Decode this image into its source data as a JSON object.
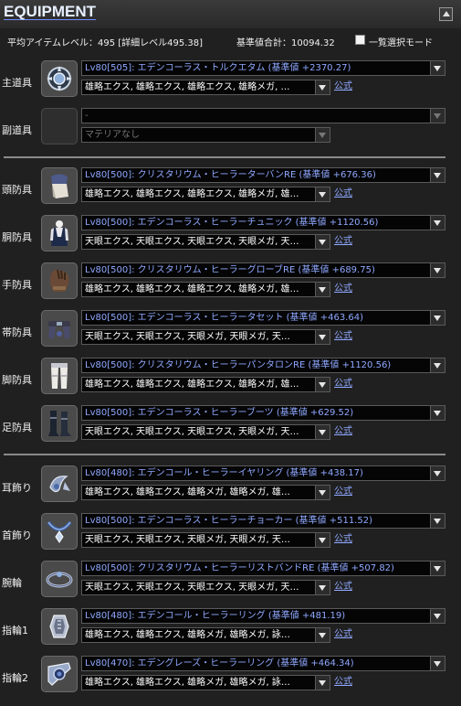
{
  "header": {
    "title": "EQUIPMENT"
  },
  "summary": {
    "avg_level": "平均アイテムレベル：495 [詳細レベル495.38]",
    "total": "基準値合計：10094.32",
    "list_mode": "一覧選択モード"
  },
  "colors": {
    "accent": "#8fa8ff",
    "background": "#202020",
    "field": "#050505"
  },
  "slots": [
    {
      "label": "主道具",
      "icon": "main-hand-icon",
      "item": "Lv80[505]: エデンコーラス・トルクエタム (基準値 +2370.27)",
      "materia": "雄略エクス, 雄略エクス, 雄略エクス, 雄略メガ, …",
      "official": "公式"
    },
    {
      "label": "副道具",
      "icon": "empty-slot-icon",
      "item": "-",
      "materia": "マテリアなし",
      "official": ""
    },
    {
      "label": "頭防具",
      "icon": "head-gear-icon",
      "item": "Lv80[500]: クリスタリウム・ヒーラーターバンRE (基準値 +676.36)",
      "materia": "雄略エクス, 雄略エクス, 雄略エクス, 雄略メガ, 雄…",
      "official": "公式"
    },
    {
      "label": "胴防具",
      "icon": "body-gear-icon",
      "item": "Lv80[500]: エデンコーラス・ヒーラーチュニック (基準値 +1120.56)",
      "materia": "天眼エクス, 天眼エクス, 天眼エクス, 天眼メガ, 天…",
      "official": "公式"
    },
    {
      "label": "手防具",
      "icon": "hands-gear-icon",
      "item": "Lv80[500]: クリスタリウム・ヒーラーグローブRE (基準値 +689.75)",
      "materia": "雄略エクス, 雄略エクス, 雄略エクス, 雄略メガ, 雄…",
      "official": "公式"
    },
    {
      "label": "帯防具",
      "icon": "waist-gear-icon",
      "item": "Lv80[500]: エデンコーラス・ヒーラータセット (基準値 +463.64)",
      "materia": "天眼エクス, 天眼エクス, 天眼メガ, 天眼メガ, 天…",
      "official": "公式"
    },
    {
      "label": "脚防具",
      "icon": "legs-gear-icon",
      "item": "Lv80[500]: クリスタリウム・ヒーラーパンタロンRE (基準値 +1120.56)",
      "materia": "雄略エクス, 雄略エクス, 雄略エクス, 雄略メガ, 雄…",
      "official": "公式"
    },
    {
      "label": "足防具",
      "icon": "feet-gear-icon",
      "item": "Lv80[500]: エデンコーラス・ヒーラーブーツ (基準値 +629.52)",
      "materia": "天眼エクス, 天眼エクス, 天眼エクス, 天眼メガ, 天…",
      "official": "公式"
    },
    {
      "label": "耳飾り",
      "icon": "earring-icon",
      "item": "Lv80[480]: エデンコール・ヒーラーイヤリング (基準値 +438.17)",
      "materia": "雄略エクス, 雄略エクス, 雄略メガ, 雄略メガ, 雄…",
      "official": "公式"
    },
    {
      "label": "首飾り",
      "icon": "necklace-icon",
      "item": "Lv80[500]: エデンコーラス・ヒーラーチョーカー (基準値 +511.52)",
      "materia": "天眼エクス, 天眼エクス, 天眼メガ, 天眼メガ, 天…",
      "official": "公式"
    },
    {
      "label": "腕輪",
      "icon": "bracelet-icon",
      "item": "Lv80[500]: クリスタリウム・ヒーラーリストバンドRE (基準値 +507.82)",
      "materia": "天眼エクス, 天眼エクス, 天眼エクス, 天眼メガ, 天…",
      "official": "公式"
    },
    {
      "label": "指輪1",
      "icon": "ring-1-icon",
      "item": "Lv80[480]: エデンコール・ヒーラーリング (基準値 +481.19)",
      "materia": "雄略エクス, 雄略エクス, 雄略メガ, 雄略メガ, 詠…",
      "official": "公式"
    },
    {
      "label": "指輪2",
      "icon": "ring-2-icon",
      "item": "Lv80[470]: エデングレーズ・ヒーラーリング (基準値 +464.34)",
      "materia": "雄略エクス, 雄略エクス, 雄略メガ, 雄略メガ, 詠…",
      "official": "公式"
    }
  ]
}
